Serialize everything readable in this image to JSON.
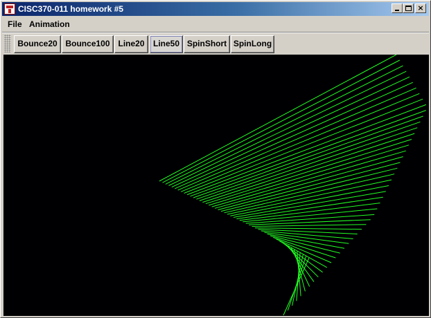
{
  "window": {
    "title": "CISC370-011 homework #5",
    "title_icon": "java-cup-icon",
    "controls": {
      "minimize": "minimize-icon",
      "maximize": "maximize-icon",
      "close_label": "×"
    }
  },
  "menubar": {
    "items": [
      {
        "label": "File"
      },
      {
        "label": "Animation"
      }
    ]
  },
  "toolbar": {
    "buttons": [
      {
        "label": "Bounce20"
      },
      {
        "label": "Bounce100"
      },
      {
        "label": "Line20"
      },
      {
        "label": "Line50"
      },
      {
        "label": "SpinShort"
      },
      {
        "label": "SpinLong"
      }
    ],
    "active": "Line50"
  },
  "canvas": {
    "background": "#000003",
    "line_color": "#22ff22",
    "line_count": 50
  }
}
